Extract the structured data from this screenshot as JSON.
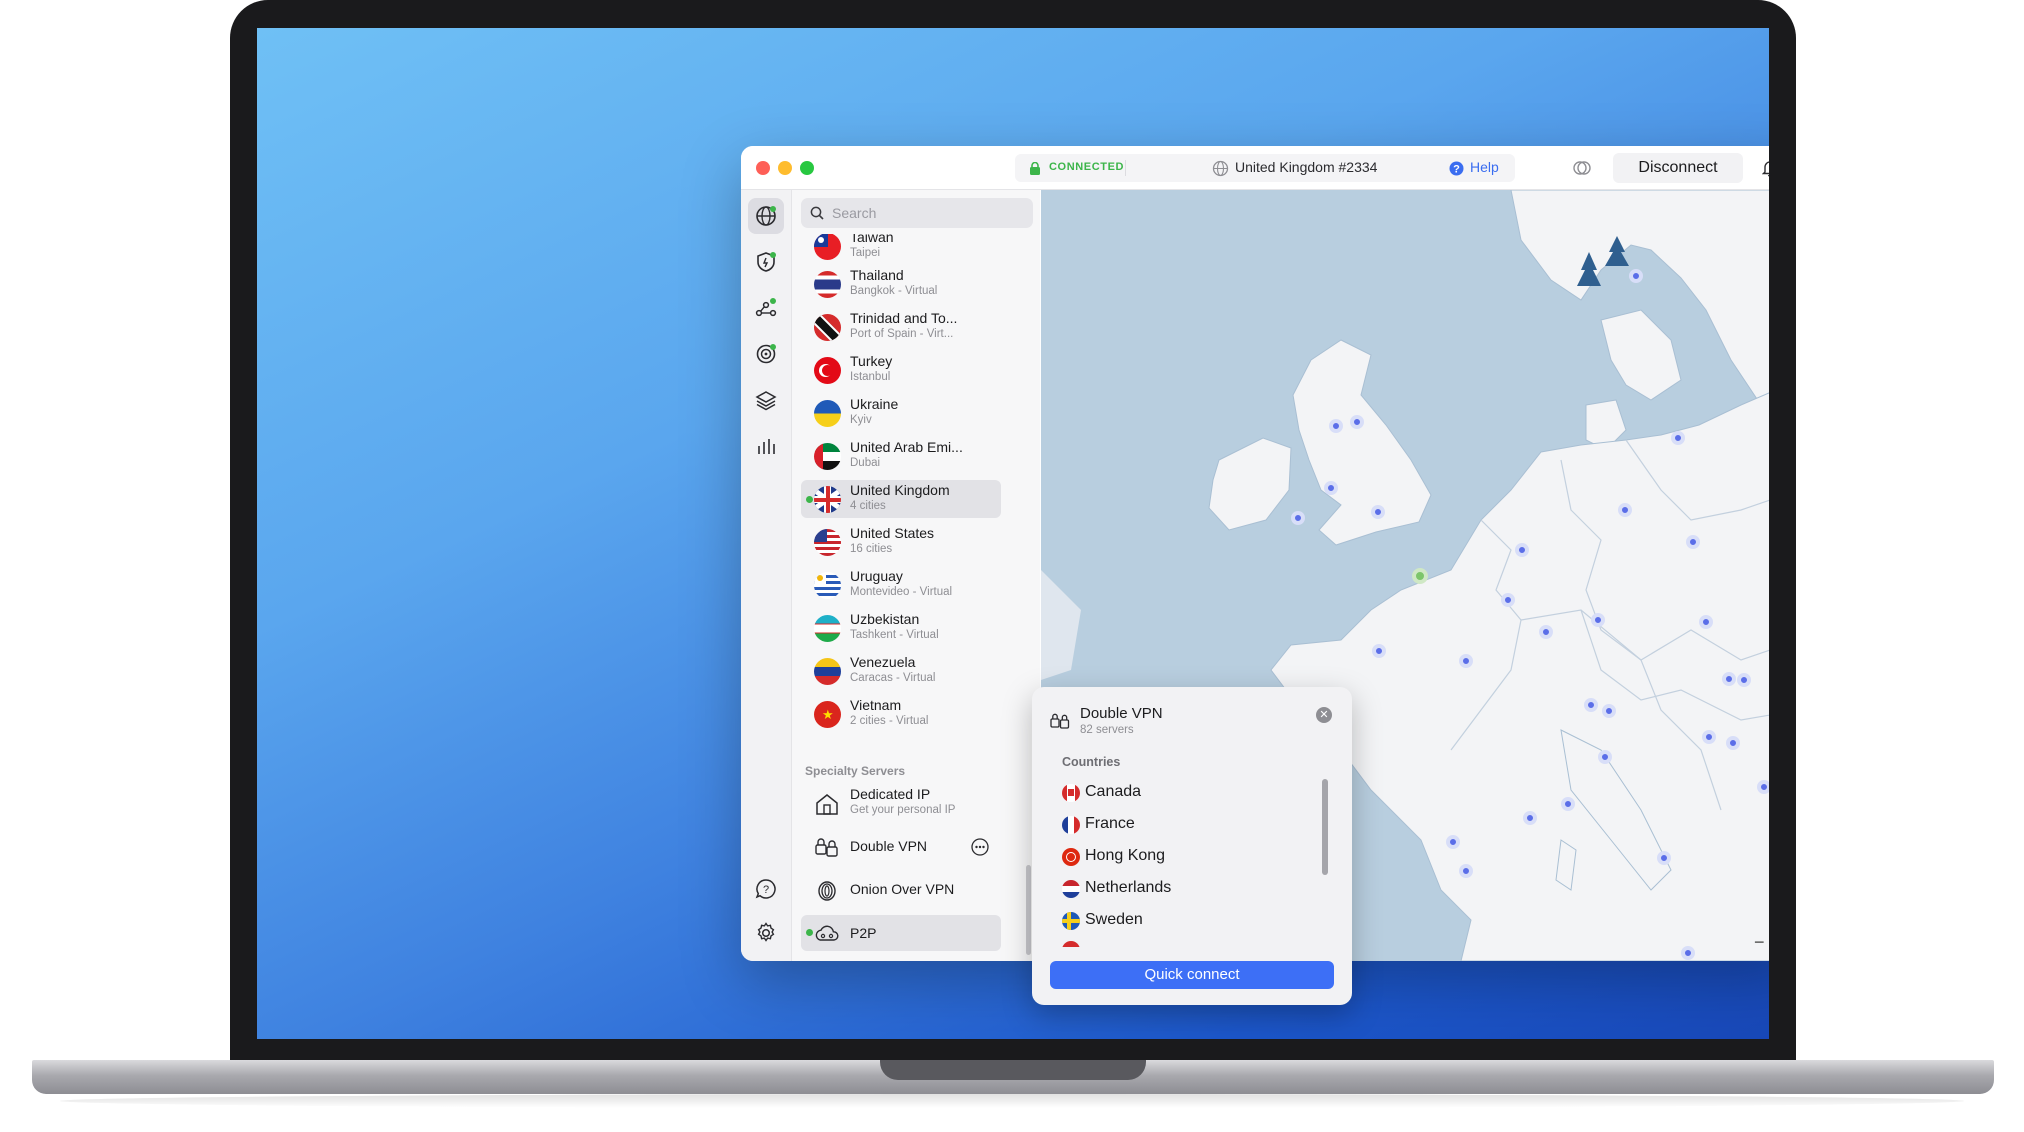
{
  "titlebar": {
    "status": "CONNECTED",
    "server": "United Kingdom #2334",
    "help": "Help",
    "disconnect": "Disconnect"
  },
  "search": {
    "placeholder": "Search"
  },
  "countries": [
    {
      "name": "Taiwan",
      "detail": "Taipei"
    },
    {
      "name": "Thailand",
      "detail": "Bangkok - Virtual"
    },
    {
      "name": "Trinidad and To...",
      "detail": "Port of Spain - Virt..."
    },
    {
      "name": "Turkey",
      "detail": "Istanbul"
    },
    {
      "name": "Ukraine",
      "detail": "Kyiv"
    },
    {
      "name": "United Arab Emi...",
      "detail": "Dubai"
    },
    {
      "name": "United Kingdom",
      "detail": "4 cities"
    },
    {
      "name": "United States",
      "detail": "16 cities"
    },
    {
      "name": "Uruguay",
      "detail": "Montevideo - Virtual"
    },
    {
      "name": "Uzbekistan",
      "detail": "Tashkent - Virtual"
    },
    {
      "name": "Venezuela",
      "detail": "Caracas - Virtual"
    },
    {
      "name": "Vietnam",
      "detail": "2 cities - Virtual"
    }
  ],
  "specialty": {
    "title": "Specialty Servers",
    "items": [
      {
        "name": "Dedicated IP",
        "detail": "Get your personal IP"
      },
      {
        "name": "Double VPN"
      },
      {
        "name": "Onion Over VPN"
      },
      {
        "name": "P2P"
      }
    ]
  },
  "popover": {
    "title": "Double VPN",
    "subtitle": "82 servers",
    "section": "Countries",
    "countries": [
      "Canada",
      "France",
      "Hong Kong",
      "Netherlands",
      "Sweden"
    ],
    "button": "Quick connect"
  },
  "map": {
    "zoom_out": "−",
    "zoom_in": "+"
  },
  "colors": {
    "accent": "#3d6ff6",
    "connected": "#3cb54a",
    "map_sea": "#b8cedf",
    "map_land": "#f3f4f6",
    "server_pin": "#5b6ee8"
  }
}
